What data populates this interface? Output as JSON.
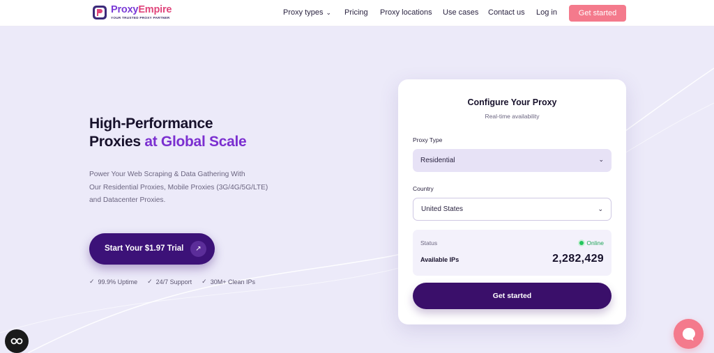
{
  "brand": {
    "name_part1": "Proxy",
    "name_part2": "Empire",
    "tagline": "YOUR TRUSTED PROXY PARTNER",
    "colors": {
      "primary": "#7a3bd6",
      "accent": "#f47a8c",
      "dark": "#3c1278"
    }
  },
  "nav": {
    "items": [
      {
        "label": "Proxy types",
        "icon": "chevron-down-icon"
      },
      {
        "label": "Pricing"
      },
      {
        "label": "Proxy locations"
      },
      {
        "label": "Use cases"
      },
      {
        "label": "Contact us"
      },
      {
        "label": "Log in"
      }
    ],
    "cta_label": "Get started"
  },
  "hero": {
    "title_line1": "High-Performance",
    "title_line2_part1": "Proxies ",
    "title_line2_part2": "at Global Scale",
    "desc_line1": "Power Your Web Scraping & Data Gathering With",
    "desc_line2": "Our Residential Proxies, Mobile Proxies (3G/4G/5G/LTE)",
    "desc_line3": "and Datacenter Proxies.",
    "cta_label": "Start Your $1.97 Trial",
    "features": [
      "99.9% Uptime",
      "24/7 Support",
      "30M+ Clean IPs"
    ]
  },
  "configurator": {
    "title": "Configure Your Proxy",
    "subtitle": "Real-time availability",
    "proxy_type_label": "Proxy Type",
    "proxy_type_value": "Residential",
    "country_label": "Country",
    "country_value": "United States",
    "status_label": "Status",
    "status_value": "Online",
    "available_ips_label": "Available IPs",
    "available_ips_value": "2,282,429",
    "button_label": "Get started"
  },
  "widgets": {
    "left_icon": "accessibility-icon",
    "right_icon": "chat-icon"
  }
}
